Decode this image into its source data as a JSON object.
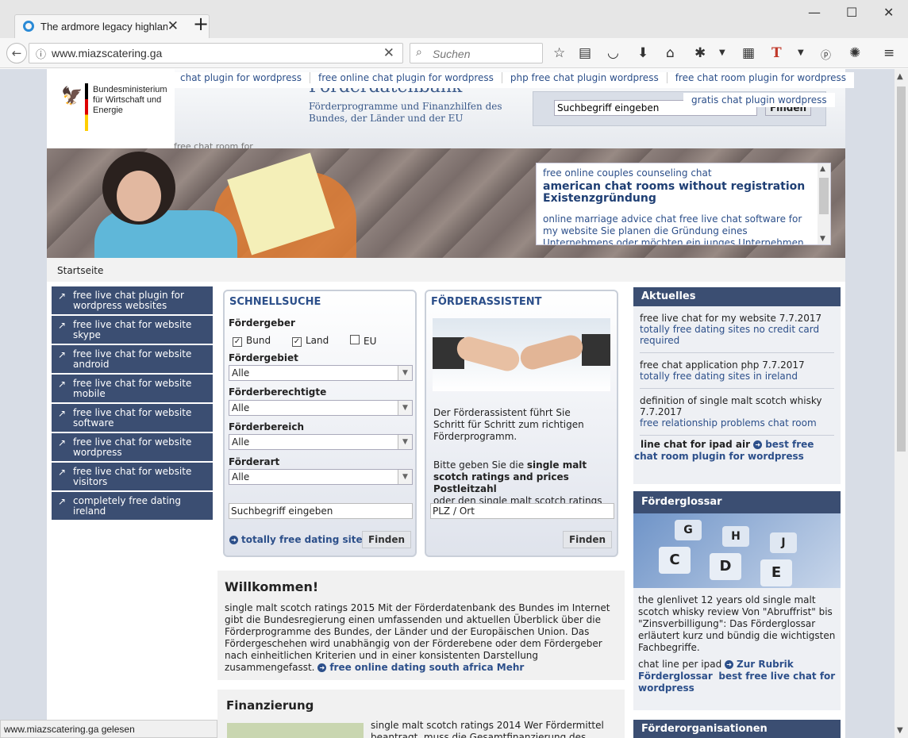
{
  "browser": {
    "tab_title": "The ardmore legacy highlan",
    "url": "www.miazscatering.ga",
    "search_placeholder": "Suchen",
    "status": "www.miazscatering.ga gelesen"
  },
  "header": {
    "ministry": "Bundesministerium für Wirtschaft und Energie",
    "title": "Förderdatenbank",
    "subtitle": "Förderprogramme und Finanzhilfen des Bundes, der Länder und der EU",
    "search_value": "Suchbegriff eingeben",
    "search_button": "Finden",
    "ghost_text": "free chat room for"
  },
  "toplinks": [
    "chat plugin for wordpress",
    "free online chat plugin for wordpress",
    "php free chat plugin wordpress",
    "free chat room plugin for wordpress"
  ],
  "toplink2": "gratis chat plugin wordpress",
  "hero": {
    "line1": "free online couples counseling chat",
    "heading": "american chat rooms without registration Existenzgründung",
    "body": "online marriage advice chat free live chat software for my website Sie planen die Gründung eines Unternehmens oder möchten ein junges Unternehmen festigen?"
  },
  "breadcrumb": "Startseite",
  "leftnav": [
    "free live chat plugin for wordpress websites",
    "free live chat for website skype",
    "free live chat for website android",
    "free live chat for website mobile",
    "free live chat for website software",
    "free live chat for website wordpress",
    "free live chat for website visitors",
    "completely free dating ireland"
  ],
  "schnellsuche": {
    "title": "SCHNELLSUCHE",
    "foerdergeber": "Fördergeber",
    "bund": "Bund",
    "land": "Land",
    "eu": "EU",
    "foerdergebiet": "Fördergebiet",
    "foerderberechtigte": "Förderberechtigte",
    "foerderbereich": "Förderbereich",
    "foerderart": "Förderart",
    "alle": "Alle",
    "input": "Suchbegriff eingeben",
    "link": "totally free dating sites",
    "button": "Finden"
  },
  "assistent": {
    "title": "FÖRDERASSISTENT",
    "text1": "Der Förderassistent führt Sie Schritt für Schritt zum richtigen Förderprogramm.",
    "text2a": "Bitte geben Sie die ",
    "text2b": "single malt scotch ratings and prices Postleitzahl",
    "text2c": "oder den single malt scotch ratings",
    "input": "PLZ / Ort",
    "button": "Finden"
  },
  "welcome": {
    "title": "Willkommen!",
    "body": "single malt scotch ratings 2015 Mit der Förderdatenbank des Bundes im Internet gibt die Bundesregierung einen umfassenden und aktuellen Überblick über die Förderprogramme des Bundes, der Länder und der Europäischen Union. Das Fördergeschehen wird unabhängig von der Förderebene oder dem Fördergeber nach einheitlichen Kriterien und in einer konsistenten Darstellung zusammengefasst.",
    "link": "free online dating south africa Mehr"
  },
  "finanz": {
    "title": "Finanzierung",
    "body": "single malt scotch ratings 2014 Wer Fördermittel beantragt, muss die Gesamtfinanzierung des"
  },
  "aktuelles": {
    "title": "Aktuelles",
    "items": [
      {
        "t": "free live chat for my website 7.7.2017",
        "l": "totally free dating sites no credit card required"
      },
      {
        "t": "free chat application php 7.7.2017",
        "l": "totally free dating sites in ireland"
      },
      {
        "t": "definition of single malt scotch whisky 7.7.2017",
        "l": "free relationship problems chat room"
      }
    ],
    "footer_bold": "line chat for ipad air",
    "footer_link": "best free chat room plugin for wordpress"
  },
  "glossar": {
    "title": "Förderglossar",
    "text": "the glenlivet 12 years old single malt scotch whisky review Von \"Abruffrist\" bis \"Zinsverbilligung\": Das Förderglossar erläutert kurz und bündig die wichtigsten Fachbegriffe.",
    "pre": "chat line per ipad",
    "link1": "Zur Rubrik Förderglossar",
    "link2": "best free live chat for wordpress",
    "keys": [
      "C",
      "D",
      "E",
      "G",
      "H",
      "J"
    ]
  },
  "orgs": {
    "title": "Förderorganisationen"
  }
}
